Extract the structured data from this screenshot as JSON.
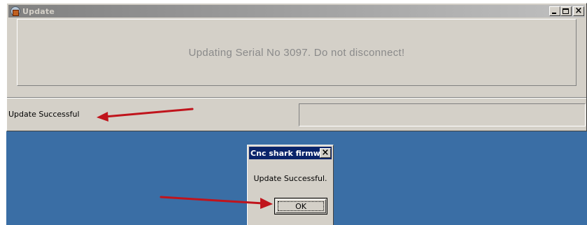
{
  "main_window": {
    "title": "Update",
    "message": "Updating Serial No 3097.  Do not disconnect!",
    "status": "Update Successful"
  },
  "dialog": {
    "title": "Cnc shark firmw...",
    "message": "Update Successful.",
    "ok_label": "OK"
  },
  "colors": {
    "desktop": "#3a6ea5",
    "window_face": "#d4d0c8",
    "dialog_title_active": "#0a246a",
    "annotation_arrow": "#c0141c"
  }
}
